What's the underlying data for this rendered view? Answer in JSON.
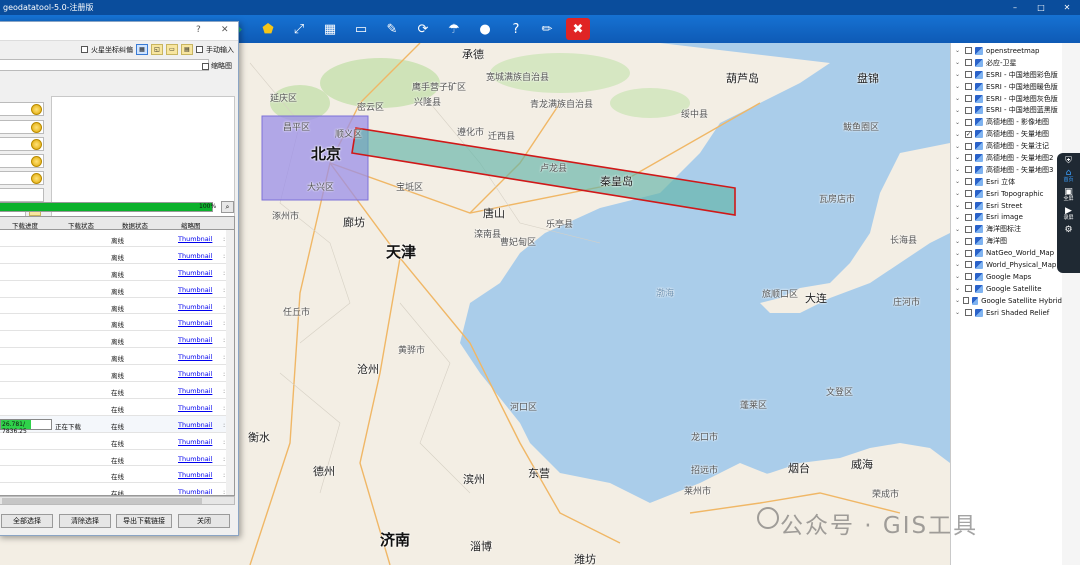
{
  "window": {
    "title": "geodatatool-5.0-注册版"
  },
  "toolbar": {
    "icons": [
      "layer-icon",
      "polygon-icon",
      "select-icon",
      "grid-icon",
      "rectangle-icon",
      "tools-icon",
      "refresh-icon",
      "upload-icon",
      "user-icon",
      "help-icon",
      "pencil-icon",
      "close-icon"
    ]
  },
  "dialog": {
    "help_glyph": "?",
    "close_glyph": "✕",
    "option_mars": "火星坐标纠偏",
    "option_manual": "手动输入",
    "option_thumb": "缩略图",
    "progress_percent": 100,
    "progress_text": "100%",
    "columns": {
      "progress": "下载进度",
      "download_status": "下载状态",
      "data_status": "数据状态",
      "thumb": "缩略图"
    },
    "rows": [
      {
        "data_status": "离线",
        "thumb": "Thumbnail"
      },
      {
        "data_status": "离线",
        "thumb": "Thumbnail"
      },
      {
        "data_status": "离线",
        "thumb": "Thumbnail"
      },
      {
        "data_status": "离线",
        "thumb": "Thumbnail"
      },
      {
        "data_status": "离线",
        "thumb": "Thumbnail"
      },
      {
        "data_status": "离线",
        "thumb": "Thumbnail"
      },
      {
        "data_status": "离线",
        "thumb": "Thumbnail"
      },
      {
        "data_status": "离线",
        "thumb": "Thumbnail"
      },
      {
        "data_status": "离线",
        "thumb": "Thumbnail"
      },
      {
        "data_status": "在线",
        "thumb": "Thumbnail"
      },
      {
        "data_status": "在线",
        "thumb": "Thumbnail"
      },
      {
        "progress_text": "26.781/ 7836.25",
        "progress_fraction": 0.6,
        "download_status": "正在下载",
        "data_status": "在线",
        "thumb": "Thumbnail"
      },
      {
        "data_status": "在线",
        "thumb": "Thumbnail"
      },
      {
        "data_status": "在线",
        "thumb": "Thumbnail"
      },
      {
        "data_status": "在线",
        "thumb": "Thumbnail"
      },
      {
        "data_status": "在线",
        "thumb": "Thumbnail"
      }
    ],
    "buttons": {
      "select_all": "全部选择",
      "clear": "清除选择",
      "export": "导出下载链接",
      "close": "关闭"
    }
  },
  "layers": [
    {
      "name": "openstreetmap",
      "checked": false
    },
    {
      "name": "必应-卫星",
      "checked": false
    },
    {
      "name": "ESRI - 中国地图彩色版",
      "checked": false
    },
    {
      "name": "ESRI - 中国地图暖色版",
      "checked": false
    },
    {
      "name": "ESRI - 中国地图灰色版",
      "checked": false
    },
    {
      "name": "ESRI - 中国地图蓝黑版",
      "checked": false
    },
    {
      "name": "高德地图 - 影像地图",
      "checked": false
    },
    {
      "name": "高德地图 - 矢量地图",
      "checked": true
    },
    {
      "name": "高德地图 - 矢量注记",
      "checked": false
    },
    {
      "name": "高德地图 - 矢量地图2",
      "checked": false
    },
    {
      "name": "高德地图 - 矢量地图3",
      "checked": false
    },
    {
      "name": "Esri 立体",
      "checked": false
    },
    {
      "name": "Esri Topographic",
      "checked": false
    },
    {
      "name": "Esri Street",
      "checked": false
    },
    {
      "name": "Esri image",
      "checked": false
    },
    {
      "name": "海洋图标注",
      "checked": false
    },
    {
      "name": "海洋图",
      "checked": false
    },
    {
      "name": "NatGeo_World_Map",
      "checked": false
    },
    {
      "name": "World_Physical_Map",
      "checked": false
    },
    {
      "name": "Google Maps",
      "checked": false
    },
    {
      "name": "Google Satellite",
      "checked": false
    },
    {
      "name": "Google Satellite Hybrid",
      "checked": false
    },
    {
      "name": "Esri Shaded Relief",
      "checked": false
    }
  ],
  "dock": [
    {
      "icon": "shield-icon",
      "label": ""
    },
    {
      "icon": "home-icon",
      "label": "首页"
    },
    {
      "icon": "screen-icon",
      "label": "全屏"
    },
    {
      "icon": "camera-icon",
      "label": "录屏"
    },
    {
      "icon": "settings-icon",
      "label": ""
    }
  ],
  "map": {
    "places": [
      {
        "name": "承德",
        "cls": "mid"
      },
      {
        "name": "宽城满族自治县",
        "cls": ""
      },
      {
        "name": "葫芦岛",
        "cls": "mid"
      },
      {
        "name": "盘锦",
        "cls": "mid"
      },
      {
        "name": "鹰手营子矿区",
        "cls": ""
      },
      {
        "name": "兴隆县",
        "cls": ""
      },
      {
        "name": "青龙满族自治县",
        "cls": ""
      },
      {
        "name": "绥中县",
        "cls": ""
      },
      {
        "name": "延庆区",
        "cls": ""
      },
      {
        "name": "密云区",
        "cls": ""
      },
      {
        "name": "昌平区",
        "cls": ""
      },
      {
        "name": "顺义区",
        "cls": ""
      },
      {
        "name": "北京",
        "cls": "big"
      },
      {
        "name": "遵化市",
        "cls": ""
      },
      {
        "name": "迁西县",
        "cls": ""
      },
      {
        "name": "鲅鱼圈区",
        "cls": ""
      },
      {
        "name": "唐山",
        "cls": "mid"
      },
      {
        "name": "秦皇岛",
        "cls": "mid"
      },
      {
        "name": "卢龙县",
        "cls": ""
      },
      {
        "name": "大兴区",
        "cls": ""
      },
      {
        "name": "宝坻区",
        "cls": ""
      },
      {
        "name": "廊坊",
        "cls": "mid"
      },
      {
        "name": "涿州市",
        "cls": ""
      },
      {
        "name": "天津",
        "cls": "big"
      },
      {
        "name": "滦南县",
        "cls": ""
      },
      {
        "name": "瓦房店市",
        "cls": ""
      },
      {
        "name": "乐亭县",
        "cls": ""
      },
      {
        "name": "曹妃甸区",
        "cls": ""
      },
      {
        "name": "渤海",
        "cls": "water"
      },
      {
        "name": "旅顺口区",
        "cls": ""
      },
      {
        "name": "大连",
        "cls": "mid"
      },
      {
        "name": "沧州",
        "cls": "mid"
      },
      {
        "name": "黄骅市",
        "cls": ""
      },
      {
        "name": "任丘市",
        "cls": ""
      },
      {
        "name": "衡水",
        "cls": "mid"
      },
      {
        "name": "德州",
        "cls": "mid"
      },
      {
        "name": "滨州",
        "cls": "mid"
      },
      {
        "name": "东营",
        "cls": "mid"
      },
      {
        "name": "烟台",
        "cls": "mid"
      },
      {
        "name": "威海",
        "cls": "mid"
      },
      {
        "name": "济南",
        "cls": "big"
      },
      {
        "name": "淄博",
        "cls": "mid"
      },
      {
        "name": "潍坊",
        "cls": "mid"
      },
      {
        "name": "河口区",
        "cls": ""
      },
      {
        "name": "龙口市",
        "cls": ""
      },
      {
        "name": "蓬莱区",
        "cls": ""
      },
      {
        "name": "招远市",
        "cls": ""
      },
      {
        "name": "莱州市",
        "cls": ""
      },
      {
        "name": "文登区",
        "cls": ""
      },
      {
        "name": "荣成市",
        "cls": ""
      },
      {
        "name": "长海县",
        "cls": ""
      },
      {
        "name": "庄河市",
        "cls": ""
      }
    ]
  },
  "watermark": {
    "text": "公众号 · GIS工具"
  }
}
